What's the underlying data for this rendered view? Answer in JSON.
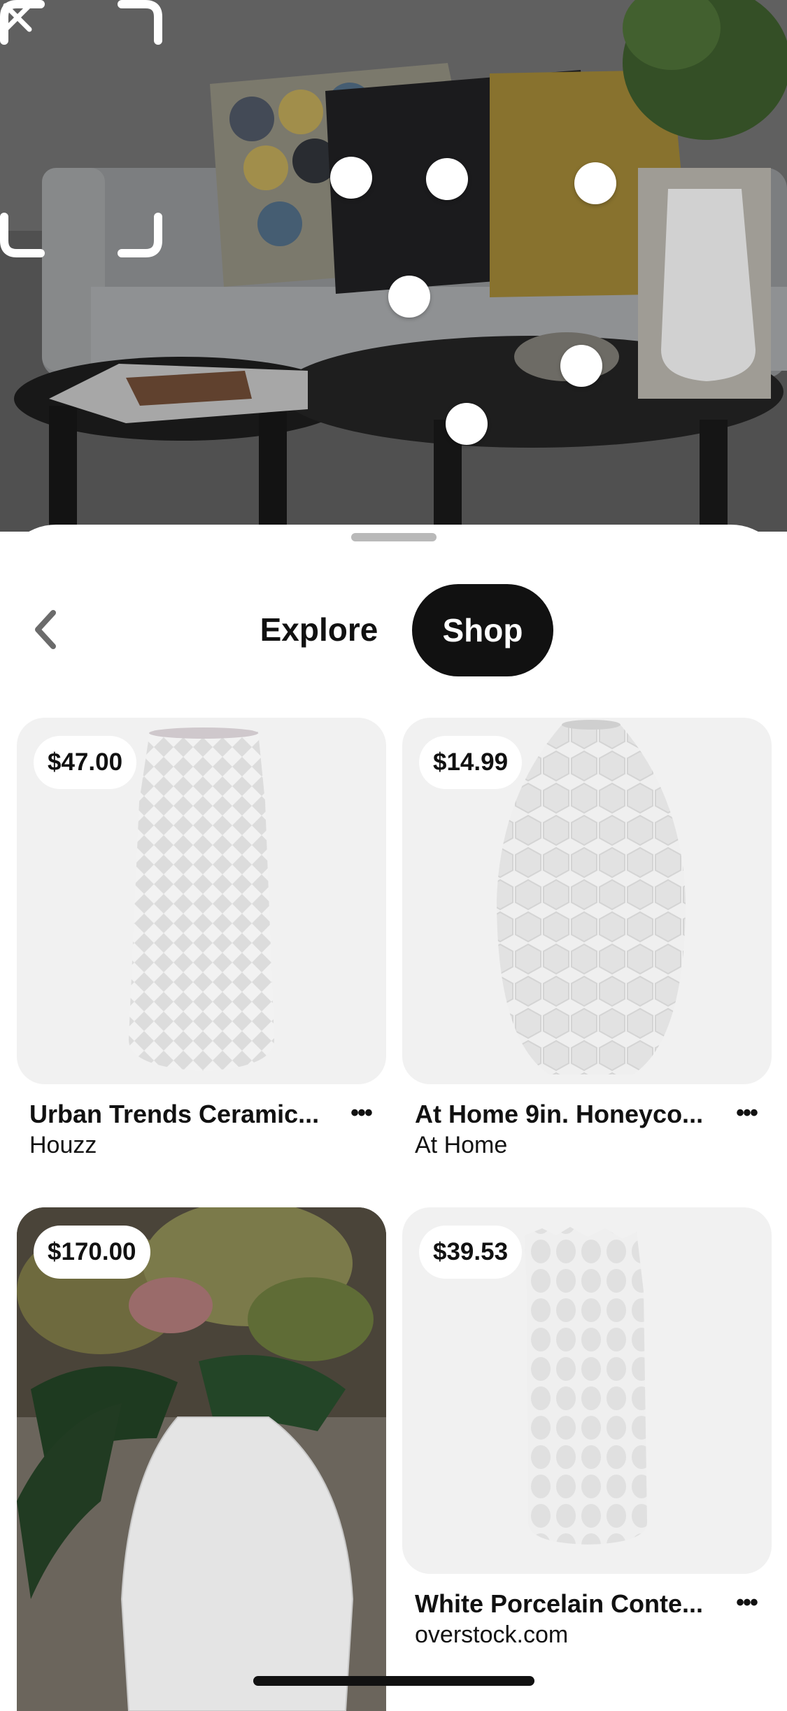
{
  "hero": {
    "image": "living-room-photo",
    "hotspot_count": 6,
    "crop_frame": "selected-vase-crop",
    "close_icon": "close-icon"
  },
  "sheet": {
    "back_icon": "chevron-left-icon",
    "tabs": [
      {
        "label": "Explore",
        "selected": false
      },
      {
        "label": "Shop",
        "selected": true
      }
    ]
  },
  "products": [
    {
      "price": "$47.00",
      "title": "Urban Trends Ceramic...",
      "source": "Houzz",
      "more_icon": "more-horizontal-icon"
    },
    {
      "price": "$14.99",
      "title": "At Home 9in. Honeyco...",
      "source": "At Home",
      "more_icon": "more-horizontal-icon"
    },
    {
      "price": "$170.00",
      "title": "",
      "source": "",
      "more_icon": ""
    },
    {
      "price": "$39.53",
      "title": "White Porcelain Conte...",
      "source": "overstock.com",
      "more_icon": "more-horizontal-icon"
    }
  ],
  "more_glyph": "•••",
  "colors": {
    "selected_tab_bg": "#111111",
    "selected_tab_text": "#ffffff",
    "card_bg": "#f1f1f1"
  }
}
